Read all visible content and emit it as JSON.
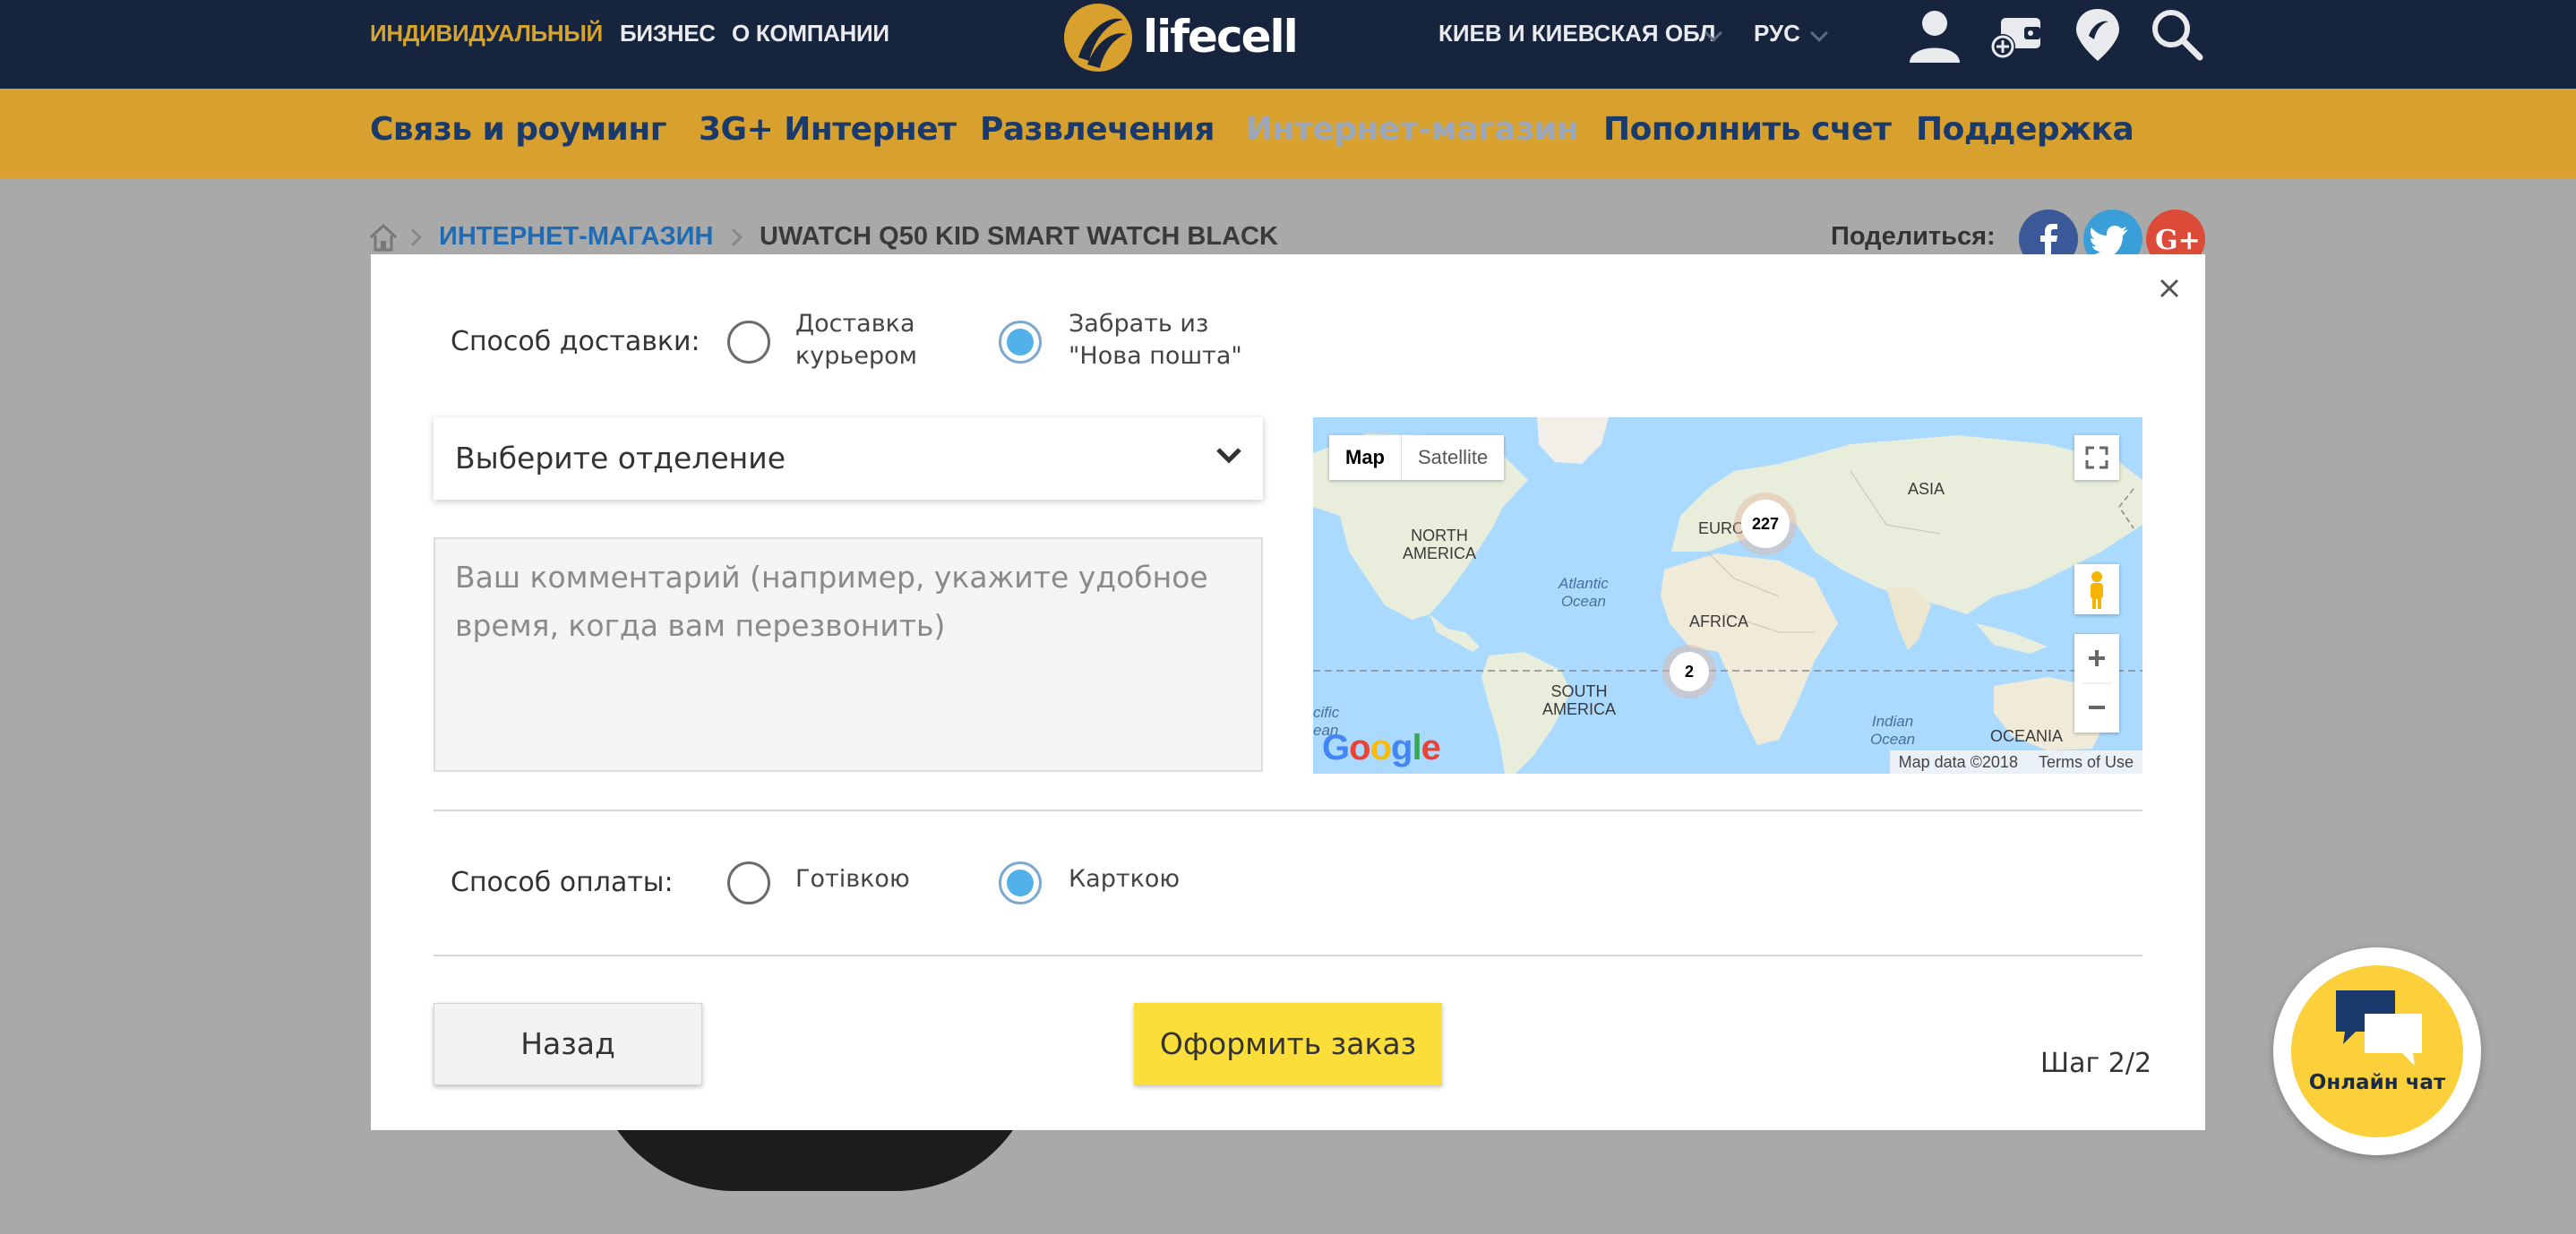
{
  "top_nav": {
    "items": [
      {
        "label": "ИНДИВИДУАЛЬНЫЙ",
        "active": true
      },
      {
        "label": "БИЗНЕС",
        "active": false
      },
      {
        "label": "О КОМПАНИИ",
        "active": false
      }
    ],
    "logo_text": "lifecell",
    "region_label": "КИЕВ И КИЕВСКАЯ ОБЛ",
    "language_label": "РУС",
    "icons": [
      "user-icon",
      "wallet-add-icon",
      "location-pin-icon",
      "search-icon"
    ]
  },
  "main_menu": {
    "items": [
      {
        "label": "Связь и роуминг",
        "muted": false
      },
      {
        "label": "3G+ Интернет",
        "muted": false
      },
      {
        "label": "Развлечения",
        "muted": false
      },
      {
        "label": "Интернет-магазин",
        "muted": true
      },
      {
        "label": "Пополнить счет",
        "muted": false
      },
      {
        "label": "Поддержка",
        "muted": false
      }
    ]
  },
  "breadcrumb": {
    "link": "ИНТЕРНЕТ-МАГАЗИН",
    "current": "UWATCH Q50 KID SMART WATCH BLACK"
  },
  "share": {
    "label": "Поделиться:",
    "networks": [
      "facebook-icon",
      "twitter-icon",
      "google-plus-icon"
    ]
  },
  "modal": {
    "delivery": {
      "label": "Способ доставки:",
      "options": [
        {
          "text_line1": "Доставка",
          "text_line2": "курьером",
          "selected": false
        },
        {
          "text_line1": "Забрать из",
          "text_line2": "\"Нова пошта\"",
          "selected": true
        }
      ]
    },
    "branch_select": {
      "value": "Выберите отделение"
    },
    "comment": {
      "placeholder": "Ваш комментарий (например, укажите удобное время, когда вам перезвонить)"
    },
    "map": {
      "type_map": "Map",
      "type_satellite": "Satellite",
      "labels": {
        "north_america": "NORTH\nAMERICA",
        "europe": "EURO",
        "asia": "ASIA",
        "atlantic": "Atlantic\nOcean",
        "africa": "AFRICA",
        "south_america": "SOUTH\nAMERICA",
        "indian": "Indian\nOcean",
        "oceania": "OCEANIA",
        "pacific": "cific\nean"
      },
      "clusters": [
        {
          "count": "227"
        },
        {
          "count": "2"
        }
      ],
      "attribution": "Map data ©2018",
      "terms": "Terms of Use",
      "google_letters": [
        "G",
        "o",
        "o",
        "g",
        "l",
        "e"
      ],
      "google_colors": [
        "#4285f4",
        "#ea4335",
        "#fbbc05",
        "#4285f4",
        "#34a853",
        "#ea4335"
      ]
    },
    "payment": {
      "label": "Способ оплаты:",
      "options": [
        {
          "text": "Готівкою",
          "selected": false
        },
        {
          "text": "Карткою",
          "selected": true
        }
      ]
    },
    "back_button": "Назад",
    "order_button": "Оформить заказ",
    "step": "Шаг 2/2"
  },
  "chat": {
    "label": "Онлайн чат"
  },
  "colors": {
    "header_bg": "#16243e",
    "menu_bg": "#d8a12d",
    "accent_gold": "#d5a42d",
    "link_blue": "#1d6cb5",
    "radio_fill": "#52b1e8",
    "order_yellow": "#fbde3a"
  }
}
